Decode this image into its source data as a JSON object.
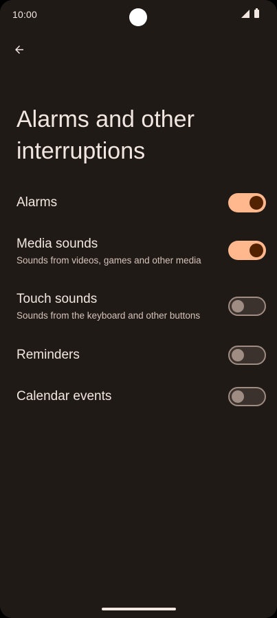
{
  "status_bar": {
    "time": "10:00"
  },
  "header": {
    "title": "Alarms and other interruptions"
  },
  "settings": [
    {
      "title": "Alarms",
      "summary": "",
      "enabled": true
    },
    {
      "title": "Media sounds",
      "summary": "Sounds from videos, games and other media",
      "enabled": true
    },
    {
      "title": "Touch sounds",
      "summary": "Sounds from the keyboard and other buttons",
      "enabled": false
    },
    {
      "title": "Reminders",
      "summary": "",
      "enabled": false
    },
    {
      "title": "Calendar events",
      "summary": "",
      "enabled": false
    }
  ],
  "colors": {
    "background": "#201a17",
    "switch_on_track": "#ffb78e",
    "switch_on_thumb": "#532200",
    "switch_off_track": "#3c322d",
    "switch_off_outline": "#9f8d84"
  },
  "icons": {
    "back": "arrow-back-icon",
    "signal": "signal-icon",
    "battery": "battery-icon"
  }
}
